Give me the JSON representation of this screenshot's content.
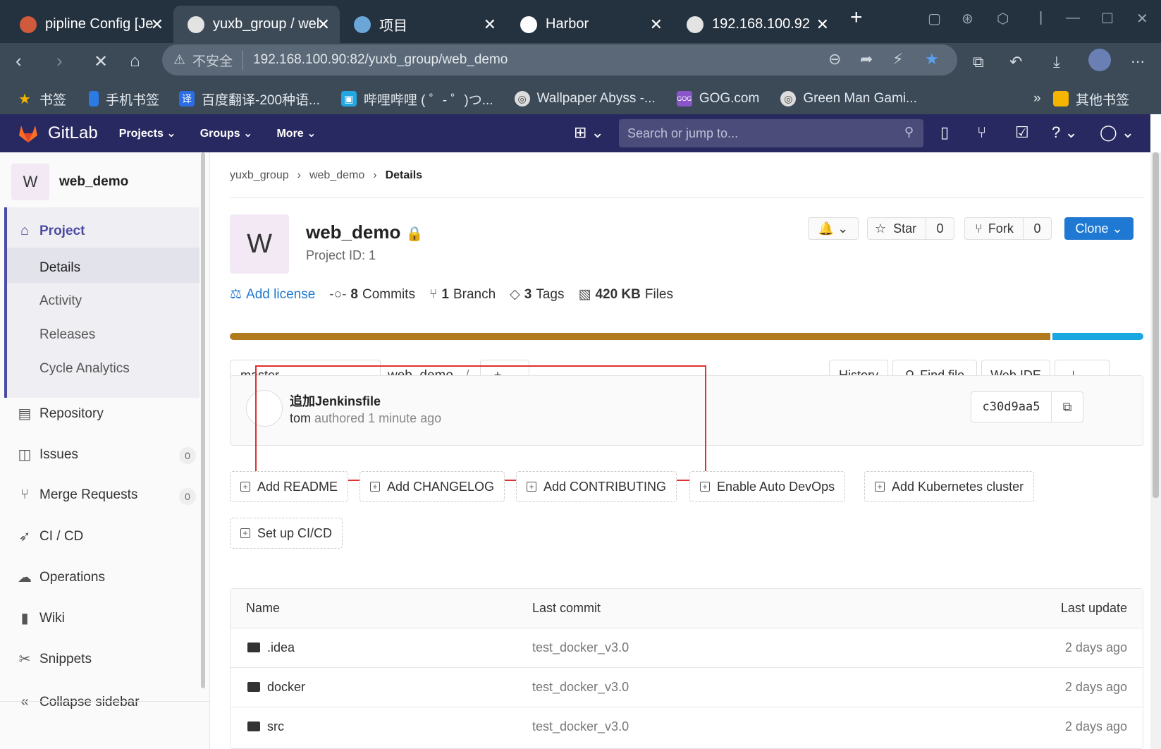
{
  "browser": {
    "tabs": [
      {
        "title": "pipline Config [Je",
        "favicon_color": "#cf5a3c"
      },
      {
        "title": "yuxb_group / wel",
        "favicon_color": "#e3e3e3"
      },
      {
        "title": "项目",
        "favicon_color": "#6aa7d8"
      },
      {
        "title": "Harbor",
        "favicon_color": "#ffffff"
      },
      {
        "title": "192.168.100.92",
        "favicon_color": "#e3e3e3"
      }
    ],
    "new_tab": "+",
    "address": {
      "security": "不安全",
      "url": "192.168.100.90:82/yuxb_group/web_demo"
    },
    "bookmarks": [
      {
        "label": "书签",
        "color": "#f4b400"
      },
      {
        "label": "手机书签",
        "color": "#2c7be5"
      },
      {
        "label": "百度翻译-200种语...",
        "color": "#2b6de5"
      },
      {
        "label": "哔哩哔哩 ( ゜- ゜)つ...",
        "color": "#23a7e3"
      },
      {
        "label": "Wallpaper Abyss -...",
        "color": "#cccccc"
      },
      {
        "label": "GOG.com",
        "color": "#8a55c9"
      },
      {
        "label": "Green Man Gami...",
        "color": "#cccccc"
      }
    ],
    "bookmarks_more": "»",
    "other_bookmarks": "其他书签"
  },
  "gitlab": {
    "brand": "GitLab",
    "menu": [
      "Projects",
      "Groups",
      "More"
    ],
    "search_placeholder": "Search or jump to..."
  },
  "sidebar": {
    "avatar_letter": "W",
    "project_name": "web_demo",
    "project_label": "Project",
    "project_sub": [
      "Details",
      "Activity",
      "Releases",
      "Cycle Analytics"
    ],
    "items": [
      {
        "label": "Repository",
        "icon": "book-icon"
      },
      {
        "label": "Issues",
        "icon": "issues-icon",
        "count": "0"
      },
      {
        "label": "Merge Requests",
        "icon": "merge-request-icon",
        "count": "0"
      },
      {
        "label": "CI / CD",
        "icon": "rocket-icon"
      },
      {
        "label": "Operations",
        "icon": "cloud-gear-icon"
      },
      {
        "label": "Wiki",
        "icon": "wiki-icon"
      },
      {
        "label": "Snippets",
        "icon": "scissors-icon"
      }
    ],
    "collapse": "Collapse sidebar"
  },
  "main": {
    "breadcrumb": [
      "yuxb_group",
      "web_demo",
      "Details"
    ],
    "avatar_letter": "W",
    "title": "web_demo",
    "project_id": "Project ID: 1",
    "notify_label": "",
    "star": {
      "label": "Star",
      "count": "0"
    },
    "fork": {
      "label": "Fork",
      "count": "0"
    },
    "clone": "Clone",
    "stats": {
      "license": "Add license",
      "commits_num": "8",
      "commits_label": "Commits",
      "branch_num": "1",
      "branch_label": "Branch",
      "tags_num": "3",
      "tags_label": "Tags",
      "files_num": "420 KB",
      "files_label": "Files"
    },
    "language_bar": [
      {
        "fraction": 0.9,
        "color": "#b07a1e"
      },
      {
        "fraction": 0.1,
        "color": "#1aa7e0"
      }
    ],
    "branch": "master",
    "path": "web_demo",
    "path_sep": "/",
    "history": "History",
    "find_file": "Find file",
    "web_ide": "Web IDE",
    "commit": {
      "title": "追加Jenkinsfile",
      "author": "tom",
      "meta": "authored 1 minute ago",
      "sha": "c30d9aa5"
    },
    "quick_actions": [
      "Add README",
      "Add CHANGELOG",
      "Add CONTRIBUTING",
      "Enable Auto DevOps",
      "Add Kubernetes cluster",
      "Set up CI/CD"
    ],
    "files_table": {
      "headers": [
        "Name",
        "Last commit",
        "Last update"
      ],
      "rows": [
        {
          "name": ".idea",
          "commit": "test_docker_v3.0",
          "updated": "2 days ago"
        },
        {
          "name": "docker",
          "commit": "test_docker_v3.0",
          "updated": "2 days ago"
        },
        {
          "name": "src",
          "commit": "test_docker_v3.0",
          "updated": "2 days ago"
        }
      ]
    }
  }
}
